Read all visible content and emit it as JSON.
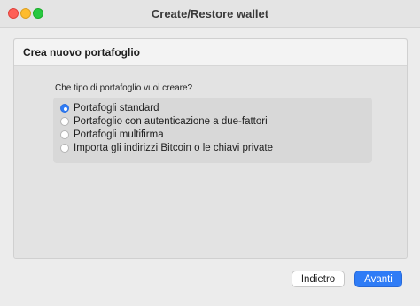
{
  "window": {
    "title": "Create/Restore wallet"
  },
  "panel": {
    "title": "Crea nuovo portafoglio",
    "question": "Che tipo di portafoglio vuoi creare?",
    "options": [
      {
        "label": "Portafogli standard",
        "selected": true
      },
      {
        "label": "Portafoglio con autenticazione a due-fattori",
        "selected": false
      },
      {
        "label": "Portafogli multifirma",
        "selected": false
      },
      {
        "label": "Importa gli indirizzi Bitcoin o le chiavi private",
        "selected": false
      }
    ]
  },
  "buttons": {
    "back_label": "Indietro",
    "next_label": "Avanti"
  },
  "colors": {
    "accent": "#2f7cf6",
    "close": "#fe5f57",
    "minimize": "#febc2e",
    "maximize": "#28c840"
  }
}
